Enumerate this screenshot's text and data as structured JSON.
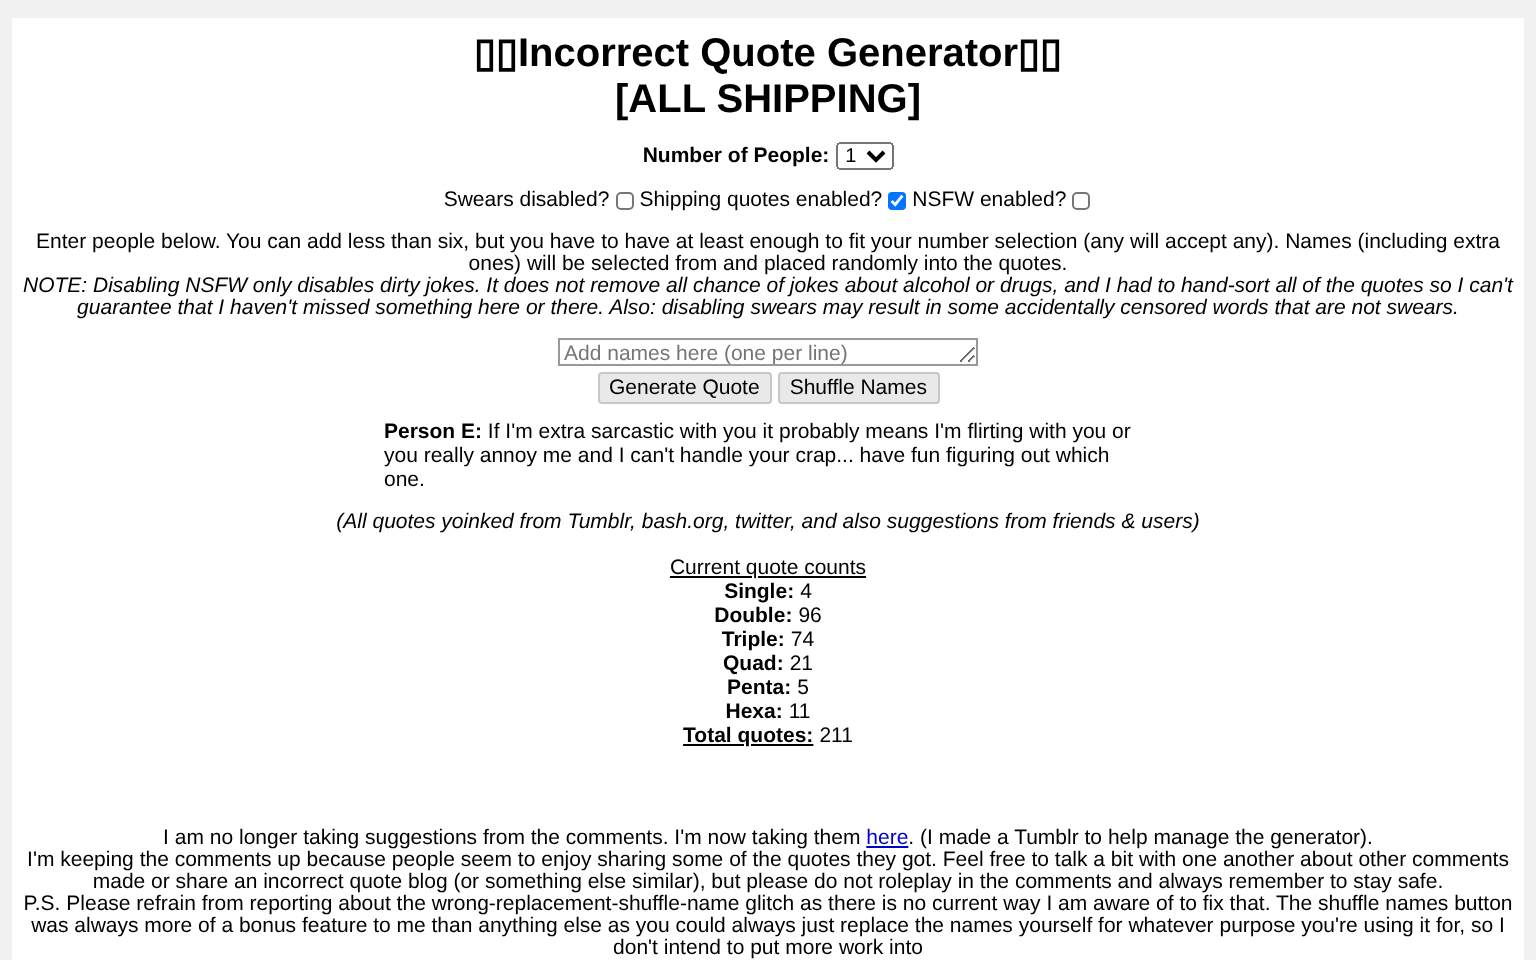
{
  "title_lines": [
    "▯▯Incorrect Quote Generator▯▯",
    "[ALL SHIPPING]"
  ],
  "people": {
    "label": "Number of People:",
    "value": "1"
  },
  "options": [
    {
      "label": "Swears disabled?",
      "checked": false
    },
    {
      "label": "Shipping quotes enabled?",
      "checked": true
    },
    {
      "label": "NSFW enabled?",
      "checked": false
    }
  ],
  "intro": "Enter people below. You can add less than six, but you have to have at least enough to fit your number selection (any will accept any). Names (including extra ones) will be selected from and placed randomly into the quotes.",
  "note": "NOTE: Disabling NSFW only disables dirty jokes. It does not remove all chance of jokes about alcohol or drugs, and I had to hand-sort all of the quotes so I can't guarantee that I haven't missed something here or there. Also: disabling swears may result in some accidentally censored words that are not swears.",
  "names_field": {
    "placeholder": "Add names here (one per line)"
  },
  "buttons": [
    "Generate Quote",
    "Shuffle Names"
  ],
  "quote": "**Person E:** If I'm extra sarcastic with you it probably means I'm flirting with you or you really annoy me and I can't handle your crap... have fun figuring out which one.",
  "credits": "(All quotes yoinked from Tumblr, bash.org, twitter, and also suggestions from friends & users)",
  "counts": {
    "heading": "Current quote counts",
    "items": [
      {
        "label": "Single:",
        "value": "4"
      },
      {
        "label": "Double:",
        "value": "96"
      },
      {
        "label": "Triple:",
        "value": "74"
      },
      {
        "label": "Quad:",
        "value": "21"
      },
      {
        "label": "Penta:",
        "value": "5"
      },
      {
        "label": "Hexa:",
        "value": "11"
      }
    ],
    "total": {
      "label": "Total quotes:",
      "value": "211"
    }
  },
  "notice": {
    "before": "I am no longer taking suggestions from the comments. I'm now taking them",
    "link": "here",
    "after": ". (I made a Tumblr to help manage the generator)."
  },
  "comments_note": "I'm keeping the comments up because people seem to enjoy sharing some of the quotes they got. Feel free to talk a bit with one another about other comments made or share an incorrect quote blog (or something else similar), but please do not roleplay in the comments and always remember to stay safe.",
  "ps": "P.S. Please refrain from reporting about the wrong-replacement-shuffle-name glitch as there is no current way I am aware of to fix that. The shuffle names button was always more of a bonus feature to me than anything else as you could always just replace the names yourself for whatever purpose you're using it for, so I don't intend to put more work into"
}
